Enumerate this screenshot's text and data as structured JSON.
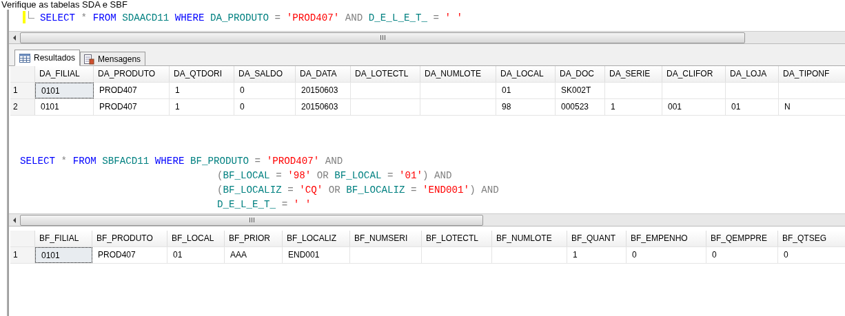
{
  "heading": "Verifique as tabelas SDA e SBF",
  "queries": [
    {
      "lines": [
        {
          "indented": false,
          "tokens": [
            {
              "kind": "kw",
              "t": "SELECT"
            },
            {
              "kind": "op",
              "t": " * "
            },
            {
              "kind": "kw",
              "t": "FROM"
            },
            {
              "kind": "id",
              "t": " SDAACD11 "
            },
            {
              "kind": "kw",
              "t": "WHERE"
            },
            {
              "kind": "id",
              "t": " DA_PRODUTO "
            },
            {
              "kind": "op",
              "t": "= "
            },
            {
              "kind": "str",
              "t": "'PROD407'"
            },
            {
              "kind": "op",
              "t": " AND "
            },
            {
              "kind": "id",
              "t": "D_E_L_E_T_ "
            },
            {
              "kind": "op",
              "t": "= "
            },
            {
              "kind": "str",
              "t": "' '"
            }
          ]
        }
      ],
      "tabs": [
        {
          "label": "Resultados",
          "kind": "grid",
          "selected": true
        },
        {
          "label": "Mensagens",
          "kind": "messages",
          "selected": false
        }
      ],
      "columns": [
        "DA_FILIAL",
        "DA_PRODUTO",
        "DA_QTDORI",
        "DA_SALDO",
        "DA_DATA",
        "DA_LOTECTL",
        "DA_NUMLOTE",
        "DA_LOCAL",
        "DA_DOC",
        "DA_SERIE",
        "DA_CLIFOR",
        "DA_LOJA",
        "DA_TIPONF"
      ],
      "rows": [
        {
          "number": "1",
          "focused": true,
          "cells": [
            "0101",
            "PROD407",
            "1",
            "0",
            "20150603",
            "",
            "",
            "01",
            "SK002T",
            "",
            "",
            "",
            ""
          ]
        },
        {
          "number": "2",
          "focused": false,
          "cells": [
            "0101",
            "PROD407",
            "1",
            "0",
            "20150603",
            "",
            "",
            "98",
            "000523",
            "1",
            "001",
            "01",
            "N"
          ]
        }
      ]
    },
    {
      "lines": [
        {
          "indented": false,
          "tokens": [
            {
              "kind": "kw",
              "t": "SELECT"
            },
            {
              "kind": "op",
              "t": " * "
            },
            {
              "kind": "kw",
              "t": "FROM"
            },
            {
              "kind": "id",
              "t": " SBFACD11 "
            },
            {
              "kind": "kw",
              "t": "WHERE"
            },
            {
              "kind": "id",
              "t": " BF_PRODUTO "
            },
            {
              "kind": "op",
              "t": "= "
            },
            {
              "kind": "str",
              "t": "'PROD407'"
            },
            {
              "kind": "op",
              "t": " AND"
            }
          ]
        },
        {
          "indented": true,
          "tokens": [
            {
              "kind": "op",
              "t": "("
            },
            {
              "kind": "id",
              "t": "BF_LOCAL "
            },
            {
              "kind": "op",
              "t": "= "
            },
            {
              "kind": "str",
              "t": "'98'"
            },
            {
              "kind": "op",
              "t": " OR "
            },
            {
              "kind": "id",
              "t": "BF_LOCAL "
            },
            {
              "kind": "op",
              "t": "= "
            },
            {
              "kind": "str",
              "t": "'01'"
            },
            {
              "kind": "op",
              "t": ") AND"
            }
          ]
        },
        {
          "indented": true,
          "tokens": [
            {
              "kind": "op",
              "t": "("
            },
            {
              "kind": "id",
              "t": "BF_LOCALIZ "
            },
            {
              "kind": "op",
              "t": "= "
            },
            {
              "kind": "str",
              "t": "'CQ'"
            },
            {
              "kind": "op",
              "t": " OR "
            },
            {
              "kind": "id",
              "t": "BF_LOCALIZ "
            },
            {
              "kind": "op",
              "t": "= "
            },
            {
              "kind": "str",
              "t": "'END001'"
            },
            {
              "kind": "op",
              "t": ") AND"
            }
          ]
        },
        {
          "indented": true,
          "tokens": [
            {
              "kind": "id",
              "t": "D_E_L_E_T_ "
            },
            {
              "kind": "op",
              "t": "= "
            },
            {
              "kind": "str",
              "t": "' '"
            }
          ]
        }
      ],
      "columns": [
        "BF_FILIAL",
        "BF_PRODUTO",
        "BF_LOCAL",
        "BF_PRIOR",
        "BF_LOCALIZ",
        "BF_NUMSERI",
        "BF_LOTECTL",
        "BF_NUMLOTE",
        "BF_QUANT",
        "BF_EMPENHO",
        "BF_QEMPPRE",
        "BF_QTSEG"
      ],
      "rows": [
        {
          "number": "1",
          "focused": true,
          "cells": [
            "0101",
            "PROD407",
            "01",
            "AAA",
            "END001",
            "",
            "",
            "",
            "1",
            "0",
            "0",
            "0"
          ]
        }
      ]
    }
  ]
}
